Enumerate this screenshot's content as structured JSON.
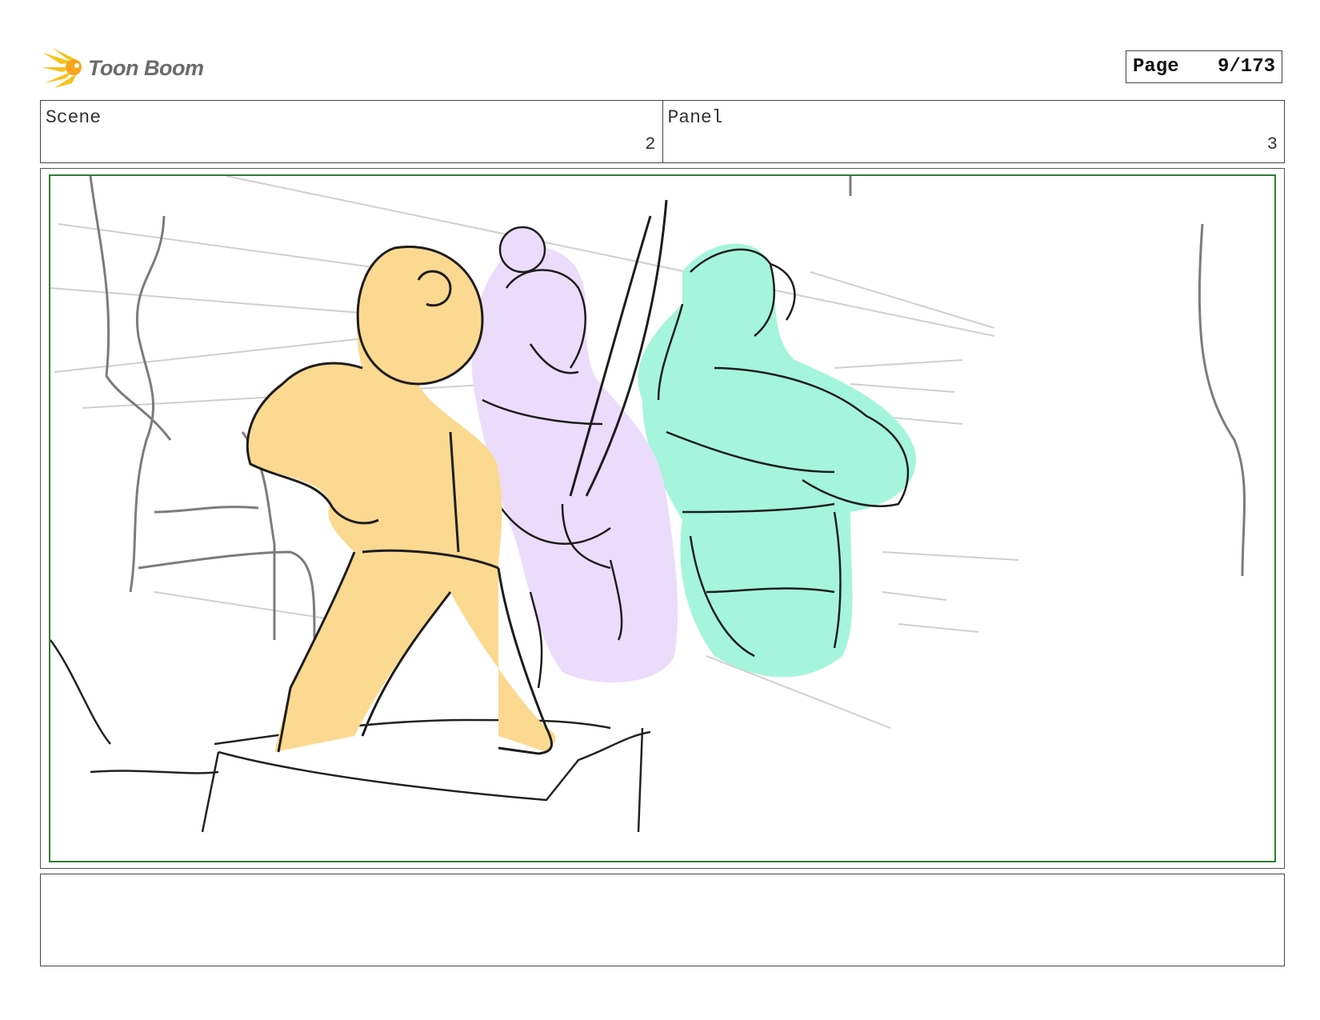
{
  "header": {
    "brand_name": "Toon Boom",
    "page_label": "Page",
    "page_value": "9/173"
  },
  "scene": {
    "label": "Scene",
    "value": "2"
  },
  "panel": {
    "label": "Panel",
    "value": "3"
  },
  "sketch": {
    "characters": [
      {
        "icon": "orange-round-headed-character",
        "color": "#fcd990"
      },
      {
        "icon": "lavender-elf-with-sword",
        "color": "#ecdcfb"
      },
      {
        "icon": "mint-muscular-elf-arms-crossed",
        "color": "#a4f5dc"
      }
    ],
    "frame_color": "#2e7d32"
  },
  "caption": {
    "text": ""
  }
}
